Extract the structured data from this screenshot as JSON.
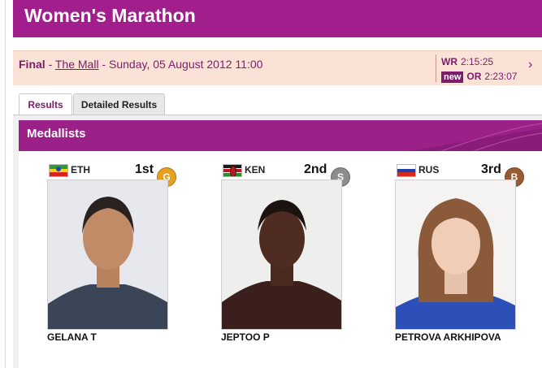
{
  "title": "Women's Marathon",
  "event": {
    "phase": "Final",
    "venue": "The Mall",
    "datetime": "- Sunday, 05 August 2012 11:00",
    "records": {
      "wr_label": "WR",
      "wr_time": "2:15:25",
      "new_label": "new",
      "or_label": "OR",
      "or_time": "2:23:07"
    }
  },
  "tabs": {
    "results": "Results",
    "detailed": "Detailed Results"
  },
  "medalists": {
    "heading": "Medallists",
    "athletes": [
      {
        "noc": "ETH",
        "place": "1st",
        "medal": "G",
        "name": "GELANA T",
        "medal_color": "#e8a021"
      },
      {
        "noc": "KEN",
        "place": "2nd",
        "medal": "S",
        "name": "JEPTOO P",
        "medal_color": "#8d8d8d"
      },
      {
        "noc": "RUS",
        "place": "3rd",
        "medal": "B",
        "name": "PETROVA ARKHIPOVA",
        "medal_color": "#9a5a32"
      }
    ]
  },
  "colors": {
    "brand": "#a21e8c",
    "accent": "#9b2189",
    "event_bg": "#fbe2d6"
  }
}
